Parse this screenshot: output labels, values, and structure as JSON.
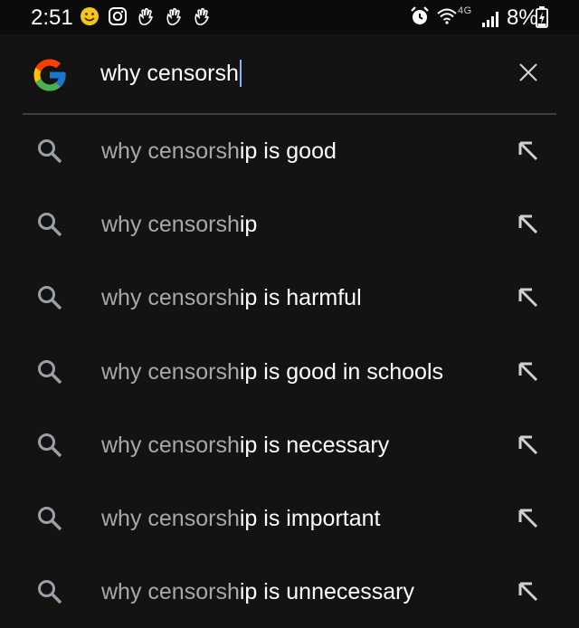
{
  "status_bar": {
    "time": "2:51",
    "network_label": "4G",
    "battery": "8%",
    "left_icons": [
      "smiley-emoji-icon",
      "instagram-icon",
      "wave-hand-icon",
      "wave-hand-icon",
      "wave-hand-icon"
    ],
    "right_icons": [
      "alarm-icon",
      "wifi-icon",
      "signal-icon",
      "battery-charging-icon"
    ]
  },
  "search": {
    "query": "why censorsh",
    "logo": "google-g-logo",
    "clear_icon": "close-icon"
  },
  "suggestions": [
    {
      "prefix": "why censorsh",
      "rest": "ip is good"
    },
    {
      "prefix": "why censorsh",
      "rest": "ip"
    },
    {
      "prefix": "why censorsh",
      "rest": "ip is harmful"
    },
    {
      "prefix": "why censorsh",
      "rest": "ip is good in schools"
    },
    {
      "prefix": "why censorsh",
      "rest": "ip is necessary"
    },
    {
      "prefix": "why censorsh",
      "rest": "ip is important"
    },
    {
      "prefix": "why censorsh",
      "rest": "ip is unnecessary"
    }
  ],
  "colors": {
    "background": "#131314",
    "status_bar": "#0b0b0c",
    "prefix_text": "#a8a8ab",
    "cursor": "#8ab4f8",
    "icon": "#9aa0a6"
  }
}
